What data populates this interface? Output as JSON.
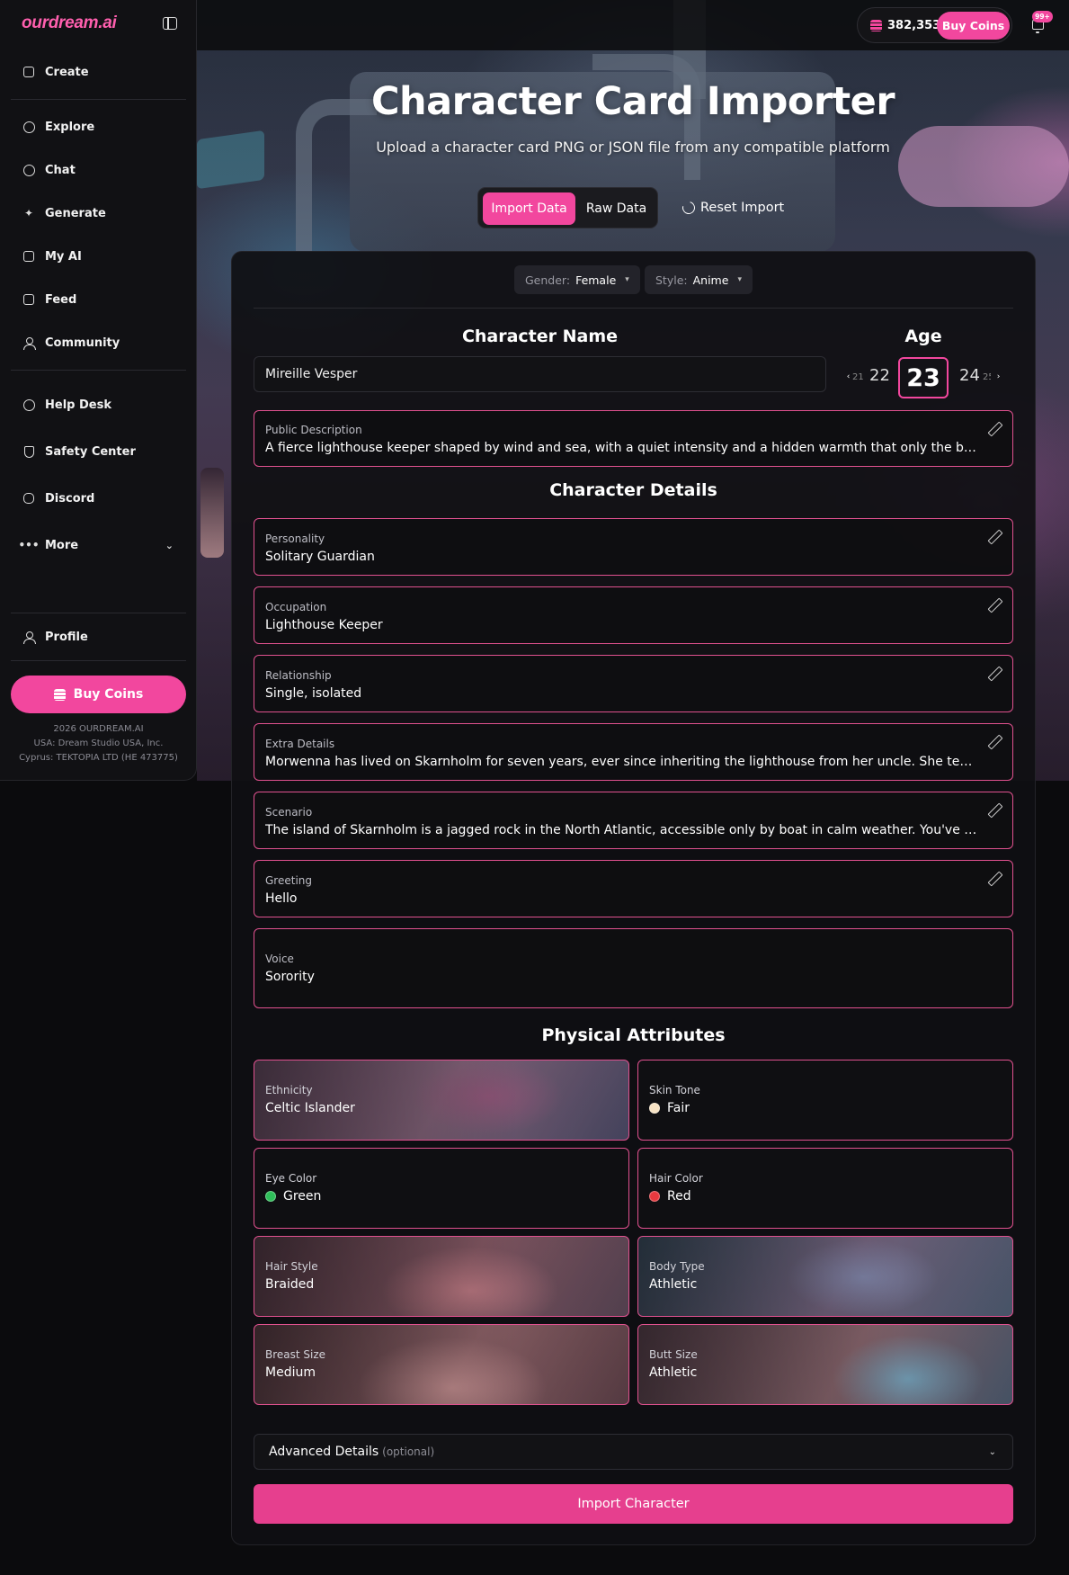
{
  "brand": {
    "logo": "ourdream.ai"
  },
  "sidebar": {
    "items": [
      {
        "label": "Create"
      },
      {
        "label": "Explore"
      },
      {
        "label": "Chat"
      },
      {
        "label": "Generate"
      },
      {
        "label": "My AI"
      },
      {
        "label": "Feed"
      },
      {
        "label": "Community"
      },
      {
        "label": "Help Desk"
      },
      {
        "label": "Safety Center"
      },
      {
        "label": "Discord"
      },
      {
        "label": "More"
      },
      {
        "label": "Profile"
      }
    ],
    "buy_label": "Buy Coins",
    "footer": [
      "2026 OURDREAM.AI",
      "USA: Dream Studio USA, Inc.",
      "Cyprus: TEKTOPIA LTD (HE 473775)"
    ]
  },
  "topbar": {
    "coins": "382,353",
    "buy_label": "Buy Coins",
    "notifications": "99+"
  },
  "hero": {
    "title": "Character Card Importer",
    "subtitle": "Upload a character card PNG or JSON file from any compatible platform",
    "tabs": [
      "Import Data",
      "Raw Data"
    ],
    "active_tab": "Import Data",
    "reset_label": "Reset Import"
  },
  "filters": {
    "gender": {
      "label": "Gender:",
      "value": "Female"
    },
    "style": {
      "label": "Style:",
      "value": "Anime"
    }
  },
  "character": {
    "name_heading": "Character Name",
    "name": "Mireille Vesper",
    "age_heading": "Age",
    "age": {
      "prev2": "21",
      "prev": "22",
      "selected": "23",
      "next": "24",
      "next2": "25"
    }
  },
  "public_description": {
    "label": "Public Description",
    "value": "A fierce lighthouse keeper shaped by wind and sea, with a quiet intensity and a hidden warmth that only the brave discover."
  },
  "details_heading": "Character Details",
  "details": [
    {
      "label": "Personality",
      "value": "Solitary Guardian"
    },
    {
      "label": "Occupation",
      "value": "Lighthouse Keeper"
    },
    {
      "label": "Relationship",
      "value": "Single, isolated"
    },
    {
      "label": "Extra Details",
      "value": "Morwenna has lived on Skarnholm for seven years, ever since inheriting the lighthouse from her uncle. She tends the light with care through every storm."
    },
    {
      "label": "Scenario",
      "value": "The island of Skarnholm is a jagged rock in the North Atlantic, accessible only by boat in calm weather. You've arrived as a stranded traveler."
    },
    {
      "label": "Greeting",
      "value": "Hello"
    }
  ],
  "voice": {
    "label": "Voice",
    "value": "Sorority"
  },
  "physical_heading": "Physical Attributes",
  "physical": [
    {
      "label": "Ethnicity",
      "value": "Celtic Islander"
    },
    {
      "label": "Skin Tone",
      "value": "Fair",
      "color": "#f7e2c4"
    },
    {
      "label": "Eye Color",
      "value": "Green",
      "color": "#2fbf5a"
    },
    {
      "label": "Hair Color",
      "value": "Red",
      "color": "#e8393f"
    },
    {
      "label": "Hair Style",
      "value": "Braided"
    },
    {
      "label": "Body Type",
      "value": "Athletic"
    },
    {
      "label": "Breast Size",
      "value": "Medium"
    },
    {
      "label": "Butt Size",
      "value": "Athletic"
    }
  ],
  "advanced": {
    "label": "Advanced Details",
    "optional": "(optional)"
  },
  "import_button": "Import Character",
  "colors": {
    "accent": "#f2479e",
    "field_border": "#e0518f",
    "background": "#0b0b0d"
  }
}
